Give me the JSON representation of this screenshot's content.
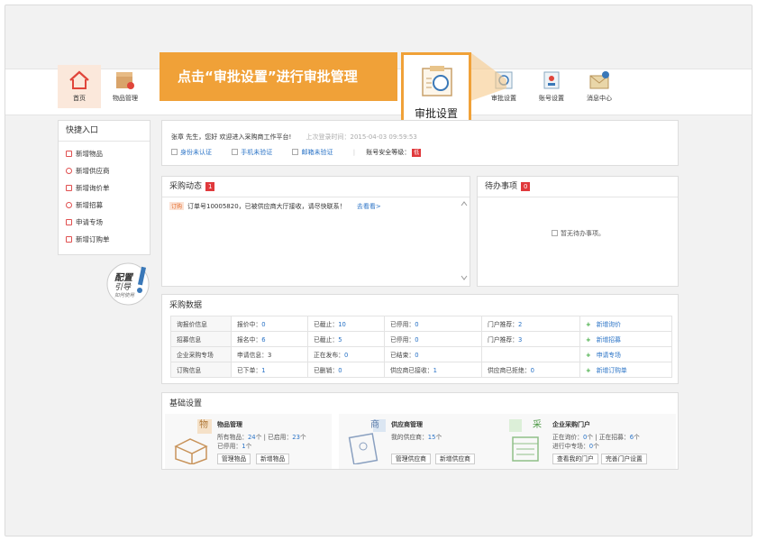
{
  "nav": {
    "home": "首页",
    "items": "物品管理",
    "approval": "审批设置",
    "account": "账号设置",
    "messages": "消息中心"
  },
  "banner": {
    "text": "点击“审批设置”进行审批管理",
    "highlight_label": "审批设置",
    "accent": "#f0a138"
  },
  "quick": {
    "title": "快捷入口",
    "items": [
      "新增物品",
      "新增供应商",
      "新增询价单",
      "新增招募",
      "申请专场",
      "新增订购单"
    ]
  },
  "guide": {
    "line1": "配置",
    "line2": "引导",
    "sub": "如何使用"
  },
  "welcome": {
    "greeting": "张章 先生，您好 欢迎进入采购商工作平台!",
    "last_login": "上次登录时间：2015-04-03 09:59:53",
    "identity": "身份未认证",
    "phone": "手机未验证",
    "email": "邮箱未验证",
    "security": "账号安全等级：",
    "security_level": "低"
  },
  "dynamics": {
    "title": "采购动态",
    "count": "1",
    "tag": "订购",
    "message": "订单号10005820，已被供应商大厅接收，请尽快联系！",
    "link": "去看看>"
  },
  "todo": {
    "title": "待办事项",
    "count": "0",
    "empty": "暂无待办事项。"
  },
  "data": {
    "title": "采购数据",
    "rows": [
      {
        "name": "询报价信息",
        "c1": "报价中：",
        "v1": "0",
        "c2": "已截止：",
        "v2": "10",
        "c3": "已停用：",
        "v3": "0",
        "c4": "门户推荐：",
        "v4": "2",
        "act": "新增询价"
      },
      {
        "name": "招募信息",
        "c1": "报名中：",
        "v1": "6",
        "c2": "已截止：",
        "v2": "5",
        "c3": "已停用：",
        "v3": "0",
        "c4": "门户推荐：",
        "v4": "3",
        "act": "新增招募"
      },
      {
        "name": "企业采购专场",
        "c1": "申请信息：",
        "v1": "3",
        "c2": "正在发布：",
        "v2": "0",
        "c3": "已结束：",
        "v3": "0",
        "c4": "",
        "v4": "",
        "act": "申请专场"
      },
      {
        "name": "订购信息",
        "c1": "已下单：",
        "v1": "1",
        "c2": "已删销：",
        "v2": "0",
        "c3": "供应商已接收：",
        "v3": "1",
        "c4": "供应商已拒绝：",
        "v4": "0",
        "act": "新增订购单"
      }
    ]
  },
  "basic": {
    "title": "基础设置",
    "goods": {
      "badge": "物",
      "title": "物品管理",
      "l1a": "所有物品：",
      "l1v": "24",
      "l1b": "个  |  已启用：",
      "l1v2": "23",
      "l1c": "个",
      "l2a": "已停用：",
      "l2v": "1",
      "l2b": "个",
      "btn1": "管理物品",
      "btn2": "新增物品"
    },
    "supplier": {
      "badge": "商",
      "title": "供应商管理",
      "l1a": "我的供应商：",
      "l1v": "15",
      "l1b": "个",
      "btn1": "管理供应商",
      "btn2": "新增供应商"
    },
    "portal": {
      "badge": "采",
      "title": "企业采购门户",
      "l1a": "正在询价：",
      "l1v": "0",
      "l1b": "个  |  正在招募：",
      "l1v2": "6",
      "l1c": "个",
      "l2a": "进行中专场：",
      "l2v": "0",
      "l2b": "个",
      "btn1": "查看我的门户",
      "btn2": "完善门户设置"
    }
  }
}
